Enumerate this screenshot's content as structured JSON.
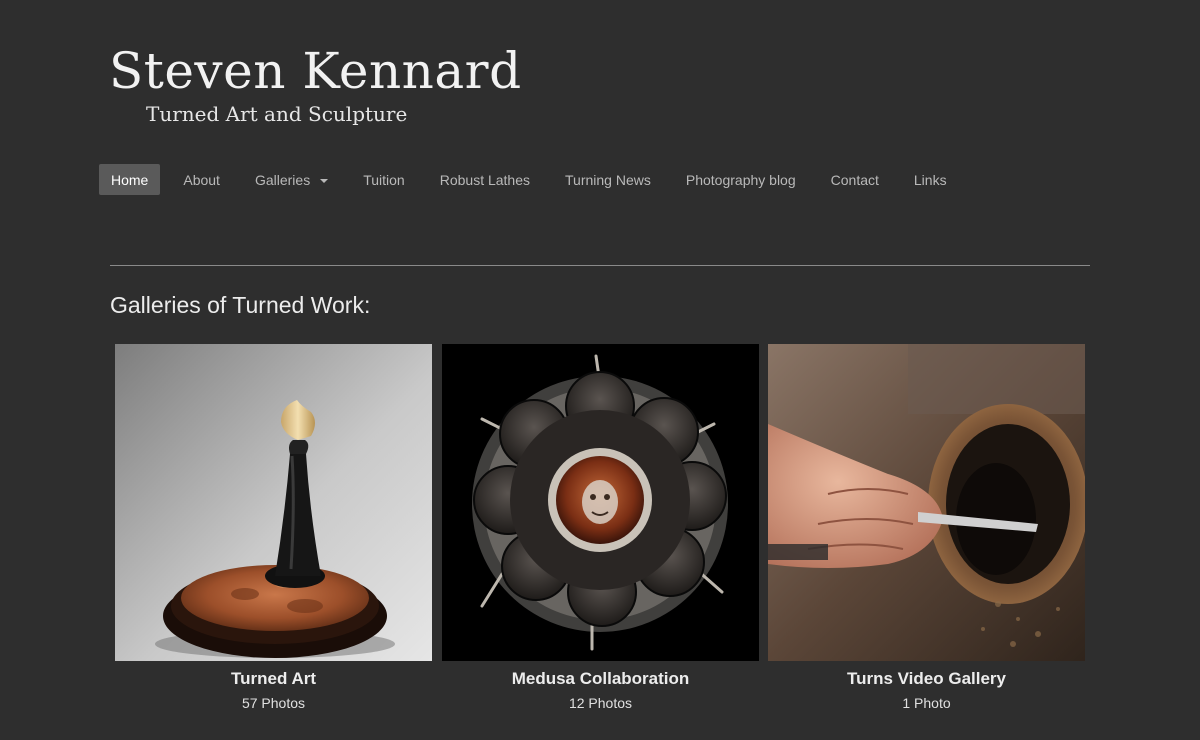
{
  "site": {
    "title": "Steven Kennard",
    "tagline": "Turned Art and Sculpture"
  },
  "nav": {
    "items": [
      {
        "label": "Home",
        "active": true
      },
      {
        "label": "About"
      },
      {
        "label": "Galleries",
        "has_dropdown": true
      },
      {
        "label": "Tuition"
      },
      {
        "label": "Robust Lathes"
      },
      {
        "label": "Turning News"
      },
      {
        "label": "Photography blog"
      },
      {
        "label": "Contact"
      },
      {
        "label": "Links"
      }
    ]
  },
  "main": {
    "heading": "Galleries of Turned Work:",
    "galleries": [
      {
        "name": "Turned Art",
        "count": "57 Photos",
        "image": "spinning-top-photo"
      },
      {
        "name": "Medusa Collaboration",
        "count": "12 Photos",
        "image": "medusa-sculpture-photo"
      },
      {
        "name": "Turns Video Gallery",
        "count": "1 Photo",
        "image": "lathe-turning-photo"
      }
    ]
  },
  "colors": {
    "background": "#2e2e2e",
    "nav_active": "#5a5a5a",
    "divider": "#8a8a8a"
  }
}
